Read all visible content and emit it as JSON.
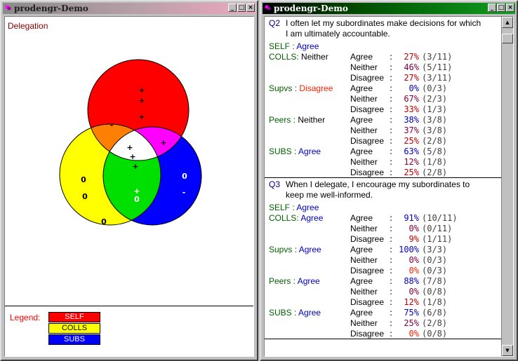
{
  "left_window": {
    "title": "prodengr-Demo",
    "heading": "Delegation",
    "venn_marks": [
      {
        "region": "self",
        "text": "+"
      },
      {
        "region": "self",
        "text": "+"
      },
      {
        "region": "self",
        "text": "+"
      },
      {
        "region": "self",
        "text": "-"
      },
      {
        "region": "self-subs",
        "text": "+"
      },
      {
        "region": "center",
        "text": "+"
      },
      {
        "region": "center",
        "text": "+"
      },
      {
        "region": "center",
        "text": "+"
      },
      {
        "region": "colls",
        "text": "0"
      },
      {
        "region": "colls",
        "text": "0"
      },
      {
        "region": "colls",
        "text": "0"
      },
      {
        "region": "colls-subs",
        "text": "+"
      },
      {
        "region": "colls-subs",
        "text": "0"
      },
      {
        "region": "subs",
        "text": "0"
      },
      {
        "region": "subs",
        "text": "-"
      }
    ],
    "legend": {
      "label": "Legend:",
      "items": [
        {
          "label": "SELF",
          "color": "#ff0000",
          "text_color": "#ffffff"
        },
        {
          "label": "COLLS",
          "color": "#ffff00",
          "text_color": "#000000"
        },
        {
          "label": "SUBS",
          "color": "#0000ff",
          "text_color": "#ffffff"
        }
      ]
    }
  },
  "right_window": {
    "title": "prodengr-Demo",
    "questions": [
      {
        "num": "Q2",
        "line1": "I often let my subordinates make decisions for which",
        "line2": "I am ultimately accountable.",
        "self": {
          "name": "SELF",
          "sep": " : ",
          "answer": "Agree",
          "answer_color": "#0000c0"
        },
        "groups": [
          {
            "name": "COLLS",
            "sep": ": ",
            "answer": "Neither",
            "answer_color": "#000000",
            "rows": [
              {
                "resp": "Agree",
                "pct": "27%",
                "cnt": "(3/11)",
                "color": "#c00000"
              },
              {
                "resp": "Neither",
                "pct": "46%",
                "cnt": "(5/11)",
                "color": "#800040"
              },
              {
                "resp": "Disagree",
                "pct": "27%",
                "cnt": "(3/11)",
                "color": "#c00000"
              }
            ]
          },
          {
            "name": "Supvs",
            "sep": " : ",
            "answer": "Disagree",
            "answer_color": "#ff2000",
            "rows": [
              {
                "resp": "Agree",
                "pct": "0%",
                "cnt": "(0/3)",
                "color": "#0000c0"
              },
              {
                "resp": "Neither",
                "pct": "67%",
                "cnt": "(2/3)",
                "color": "#800040"
              },
              {
                "resp": "Disagree",
                "pct": "33%",
                "cnt": "(1/3)",
                "color": "#c00000"
              }
            ]
          },
          {
            "name": "Peers",
            "sep": " : ",
            "answer": "Neither",
            "answer_color": "#000000",
            "rows": [
              {
                "resp": "Agree",
                "pct": "38%",
                "cnt": "(3/8)",
                "color": "#0000c0"
              },
              {
                "resp": "Neither",
                "pct": "37%",
                "cnt": "(3/8)",
                "color": "#800040"
              },
              {
                "resp": "Disagree",
                "pct": "25%",
                "cnt": "(2/8)",
                "color": "#c00000"
              }
            ]
          },
          {
            "name": "SUBS",
            "sep": " : ",
            "answer": "Agree",
            "answer_color": "#0000c0",
            "rows": [
              {
                "resp": "Agree",
                "pct": "63%",
                "cnt": "(5/8)",
                "color": "#0000c0"
              },
              {
                "resp": "Neither",
                "pct": "12%",
                "cnt": "(1/8)",
                "color": "#800040"
              },
              {
                "resp": "Disagree",
                "pct": "25%",
                "cnt": "(2/8)",
                "color": "#c00000"
              }
            ]
          }
        ]
      },
      {
        "num": "Q3",
        "line1": "When I delegate, I encourage my subordinates to",
        "line2": "keep me well-informed.",
        "self": {
          "name": "SELF",
          "sep": " : ",
          "answer": "Agree",
          "answer_color": "#0000c0"
        },
        "groups": [
          {
            "name": "COLLS",
            "sep": ": ",
            "answer": "Agree",
            "answer_color": "#0000c0",
            "rows": [
              {
                "resp": "Agree",
                "pct": "91%",
                "cnt": "(10/11)",
                "color": "#0000c0"
              },
              {
                "resp": "Neither",
                "pct": "0%",
                "cnt": "(0/11)",
                "color": "#800040"
              },
              {
                "resp": "Disagree",
                "pct": "9%",
                "cnt": "(1/11)",
                "color": "#c00000"
              }
            ]
          },
          {
            "name": "Supvs",
            "sep": " : ",
            "answer": "Agree",
            "answer_color": "#0000c0",
            "rows": [
              {
                "resp": "Agree",
                "pct": "100%",
                "cnt": "(3/3)",
                "color": "#0000c0"
              },
              {
                "resp": "Neither",
                "pct": "0%",
                "cnt": "(0/3)",
                "color": "#800040"
              },
              {
                "resp": "Disagree",
                "pct": "0%",
                "cnt": "(0/3)",
                "color": "#ff2000"
              }
            ]
          },
          {
            "name": "Peers",
            "sep": " : ",
            "answer": "Agree",
            "answer_color": "#0000c0",
            "rows": [
              {
                "resp": "Agree",
                "pct": "88%",
                "cnt": "(7/8)",
                "color": "#0000c0"
              },
              {
                "resp": "Neither",
                "pct": "0%",
                "cnt": "(0/8)",
                "color": "#800040"
              },
              {
                "resp": "Disagree",
                "pct": "12%",
                "cnt": "(1/8)",
                "color": "#c00000"
              }
            ]
          },
          {
            "name": "SUBS",
            "sep": " : ",
            "answer": "Agree",
            "answer_color": "#0000c0",
            "rows": [
              {
                "resp": "Agree",
                "pct": "75%",
                "cnt": "(6/8)",
                "color": "#0000c0"
              },
              {
                "resp": "Neither",
                "pct": "25%",
                "cnt": "(2/8)",
                "color": "#800040"
              },
              {
                "resp": "Disagree",
                "pct": "0%",
                "cnt": "(0/8)",
                "color": "#ff2000"
              }
            ]
          }
        ]
      }
    ]
  },
  "titlebar_buttons": {
    "minimize": "_",
    "maximize": "□",
    "close": "×"
  }
}
